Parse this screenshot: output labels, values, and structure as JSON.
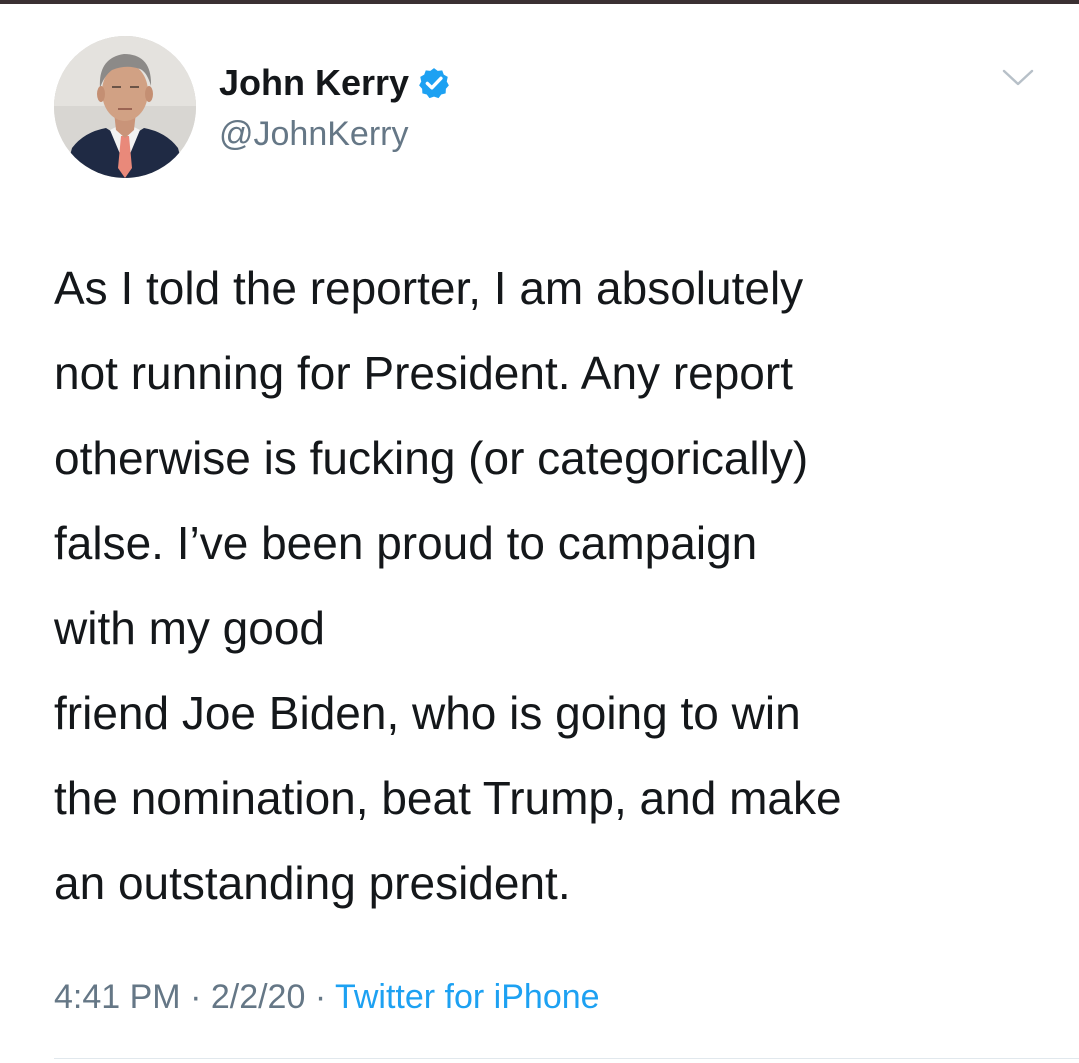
{
  "tweet": {
    "author": {
      "display_name": "John Kerry",
      "handle": "@JohnKerry",
      "verified": true,
      "avatar_icon": "profile-photo"
    },
    "menu_icon": "chevron-down-icon",
    "text_lines": [
      "As I told the reporter, I am absolutely",
      "not running for President. Any report",
      "otherwise is fucking (or categorically)",
      "false. I’ve been proud to campaign",
      "with my good",
      "friend Joe Biden, who is going to win",
      "the nomination, beat Trump, and make",
      "an outstanding president."
    ],
    "meta": {
      "time": "4:41 PM",
      "separator": " · ",
      "date": "2/2/20",
      "source": "Twitter for iPhone"
    }
  },
  "colors": {
    "text": "#14171a",
    "secondary": "#657786",
    "link": "#1da1f2",
    "verified_badge": "#1da1f2",
    "divider": "#e1e8ed"
  }
}
